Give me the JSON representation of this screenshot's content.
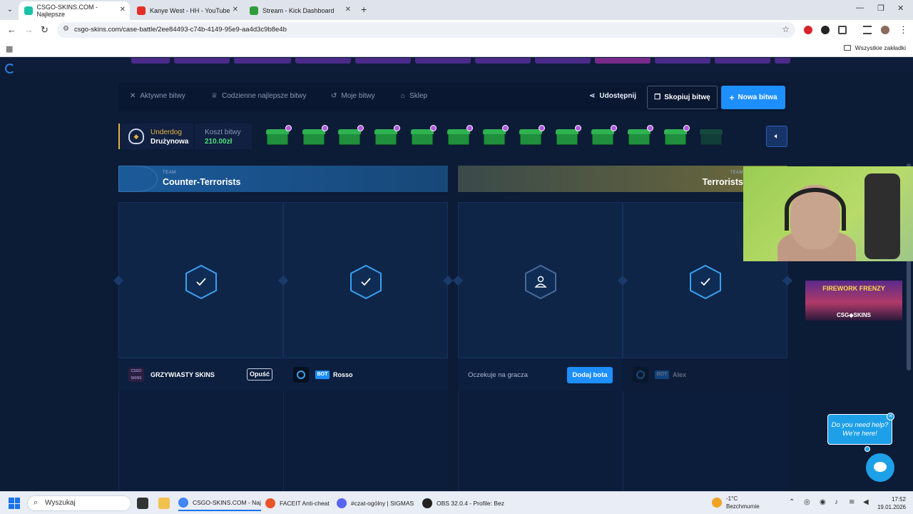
{
  "browser": {
    "tabs": [
      {
        "title": "CSGO-SKINS.COM - Najlepsze",
        "active": true,
        "color": "#19c2a8"
      },
      {
        "title": "Kanye West - HH - YouTube",
        "active": false,
        "color": "#e52d27"
      },
      {
        "title": "Stream - Kick Dashboard",
        "active": false,
        "color": "#2f9e3a"
      }
    ],
    "url": "csgo-skins.com/case-battle/2ee84493-c74b-4149-95e9-aa4d3c9b8e4b",
    "all_bookmarks": "Wszystkie zakładki"
  },
  "battle_nav": {
    "active_battles": "Aktywne bitwy",
    "daily_best": "Codzienne najlepsze bitwy",
    "my_battles": "Moje bitwy",
    "shop": "Sklep",
    "share": "Udostępnij",
    "copy_battle": "Skopiuj bitwę",
    "new_battle": "Nowa bitwa"
  },
  "battle_info": {
    "mode_line1": "Underdog",
    "mode_line2": "Drużynowa",
    "cost_label": "Koszt bitwy",
    "cost_value": "210.00zł",
    "case_count": 13,
    "case_color": "#1f8f3d"
  },
  "teams": {
    "ct": {
      "tag": "TEAM",
      "name": "Counter-Terrorists"
    },
    "t": {
      "tag": "TEAM",
      "name": "Terrorists"
    }
  },
  "players": [
    {
      "name": "GRZYWIASTY SKINS",
      "logo": "CSGO SKINS",
      "action": "Opuść",
      "status": "check"
    },
    {
      "bot_tag": "BOT",
      "name": "Rosso",
      "status": "check"
    },
    {
      "waiting": "Oczekuje na gracza",
      "action": "Dodaj bota",
      "status": "empty"
    },
    {
      "bot_tag": "BOT",
      "name": "Alex",
      "status": "check"
    }
  ],
  "promo": {
    "title": "FIREWORK FRENZY",
    "brand": "CSG◆SKINS"
  },
  "help": {
    "text": "Do you need help? We're here!"
  },
  "taskbar": {
    "search": "Wyszukaj",
    "apps": [
      {
        "label": "CSGO-SKINS.COM - Naj",
        "color": "#4285f4"
      },
      {
        "label": "FACEIT Anti-cheat",
        "color": "#e8552a"
      },
      {
        "label": "#czat-ogólny | SIGMAS",
        "color": "#5865f2"
      },
      {
        "label": "OBS 32.0.4 - Profile: Bez",
        "color": "#222222"
      }
    ],
    "weather_temp": "-1°C",
    "weather_desc": "Bezchmurnie",
    "time": "17:52",
    "date": "19.01.2026"
  },
  "colors": {
    "accent": "#1e8fff",
    "page_bg": "#0c1b36",
    "cost_green": "#4ee07a",
    "mode_gold": "#e3b341"
  }
}
